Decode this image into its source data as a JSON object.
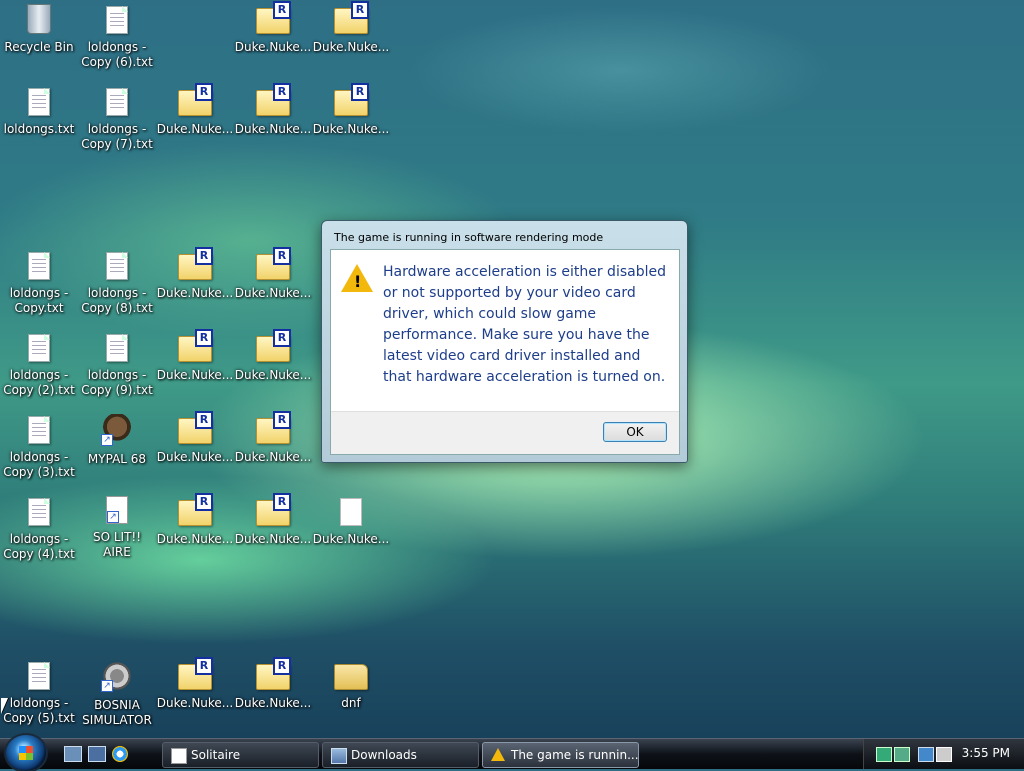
{
  "desktop": {
    "icons": [
      {
        "label": "Recycle Bin",
        "kind": "bin"
      },
      {
        "label": "loldongs - Copy (6).txt",
        "kind": "txt"
      },
      {
        "label": "Duke.Nuke...",
        "kind": "duke"
      },
      {
        "label": "Duke.Nuke...",
        "kind": "duke"
      },
      {
        "label": "loldongs.txt",
        "kind": "txt"
      },
      {
        "label": "loldongs - Copy (7).txt",
        "kind": "txt"
      },
      {
        "label": "Duke.Nuke...",
        "kind": "duke"
      },
      {
        "label": "Duke.Nuke...",
        "kind": "duke"
      },
      {
        "label": "Duke.Nuke...",
        "kind": "duke"
      },
      {
        "label": "loldongs - Copy.txt",
        "kind": "txt"
      },
      {
        "label": "loldongs - Copy (8).txt",
        "kind": "txt"
      },
      {
        "label": "Duke.Nuke...",
        "kind": "duke"
      },
      {
        "label": "Duke.Nuke...",
        "kind": "duke"
      },
      {
        "label": "loldongs - Copy (2).txt",
        "kind": "txt"
      },
      {
        "label": "loldongs - Copy (9).txt",
        "kind": "txt"
      },
      {
        "label": "Duke.Nuke...",
        "kind": "duke"
      },
      {
        "label": "Duke.Nuke...",
        "kind": "duke"
      },
      {
        "label": "loldongs - Copy (3).txt",
        "kind": "txt"
      },
      {
        "label": "MYPAL 68",
        "kind": "raccoon"
      },
      {
        "label": "Duke.Nuke...",
        "kind": "duke"
      },
      {
        "label": "Duke.Nuke...",
        "kind": "duke"
      },
      {
        "label": "loldongs - Copy (4).txt",
        "kind": "txt"
      },
      {
        "label": "SO LIT!! AIRE",
        "kind": "card"
      },
      {
        "label": "Duke.Nuke...",
        "kind": "duke"
      },
      {
        "label": "Duke.Nuke...",
        "kind": "duke"
      },
      {
        "label": "Duke.Nuke...",
        "kind": "plain"
      },
      {
        "label": "loldongs - Copy (5).txt",
        "kind": "txt"
      },
      {
        "label": "BOSNIA SIMULATOR",
        "kind": "gear"
      },
      {
        "label": "Duke.Nuke...",
        "kind": "duke"
      },
      {
        "label": "Duke.Nuke...",
        "kind": "duke"
      },
      {
        "label": "dnf",
        "kind": "folder"
      }
    ]
  },
  "dialog": {
    "title": "The game is running in software rendering mode",
    "message": "Hardware acceleration is either disabled or not supported by your video card driver, which could slow game performance. Make sure you have the latest video card driver installed and that hardware acceleration is turned on.",
    "ok_label": "OK",
    "warning_symbol": "!"
  },
  "taskbar": {
    "buttons": [
      {
        "label": "Solitaire"
      },
      {
        "label": "Downloads"
      },
      {
        "label": "The game is runnin..."
      }
    ],
    "clock": "3:55 PM"
  }
}
